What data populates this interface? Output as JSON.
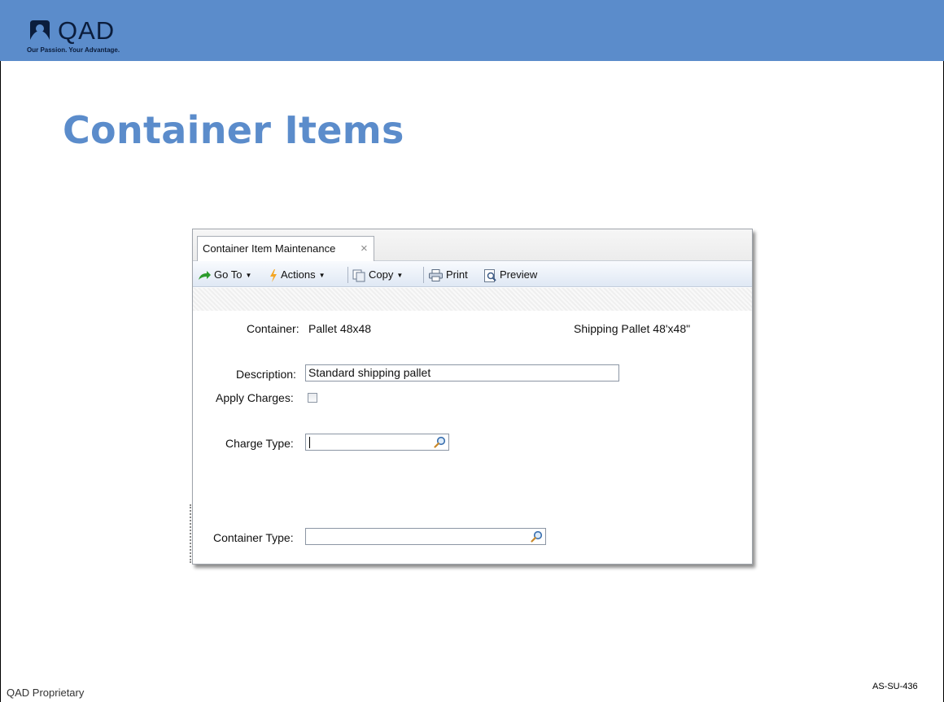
{
  "header": {
    "logo_text": "QAD",
    "tagline": "Our Passion. Your Advantage."
  },
  "title": "Container Items",
  "window": {
    "tab_label": "Container Item Maintenance",
    "tab_close": "×",
    "toolbar": {
      "goto_label": "Go To",
      "actions_label": "Actions",
      "copy_label": "Copy",
      "print_label": "Print",
      "preview_label": "Preview"
    },
    "form": {
      "container_label": "Container:",
      "container_value": "Pallet 48x48",
      "container_desc": "Shipping Pallet 48'x48\"",
      "description_label": "Description:",
      "description_value": "Standard shipping pallet",
      "apply_charges_label": "Apply Charges:",
      "apply_charges_checked": false,
      "charge_type_label": "Charge Type:",
      "charge_type_value": "",
      "container_type_label": "Container Type:",
      "container_type_value": ""
    }
  },
  "footer": {
    "left": "QAD Proprietary",
    "right": "AS-SU-436"
  },
  "colors": {
    "brand_blue": "#5b8ccb",
    "logo_navy": "#0b1d3c"
  }
}
